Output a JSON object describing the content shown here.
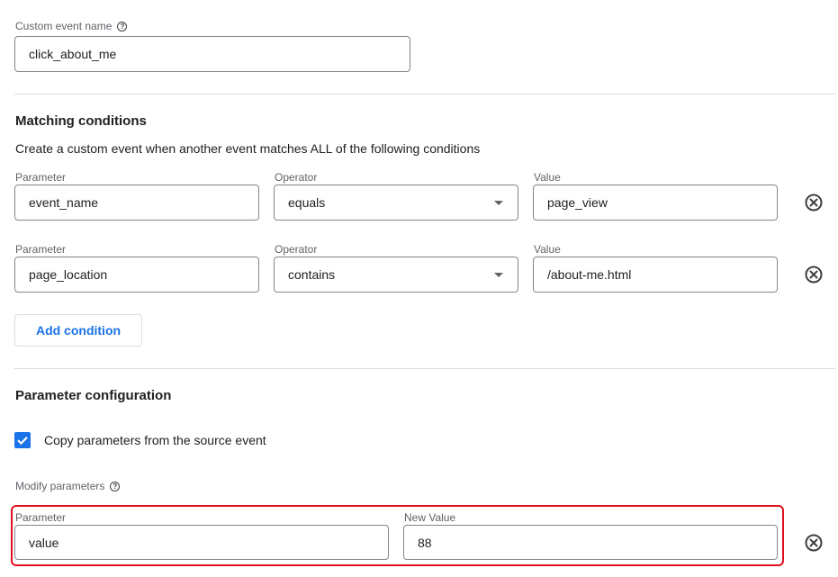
{
  "event_name": {
    "label": "Custom event name",
    "help_icon": "help-icon",
    "value": "click_about_me"
  },
  "matching": {
    "title": "Matching conditions",
    "description": "Create a custom event when another event matches ALL of the following conditions",
    "parameter_label": "Parameter",
    "operator_label": "Operator",
    "value_label": "Value",
    "conditions": [
      {
        "parameter": "event_name",
        "operator": "equals",
        "value": "page_view"
      },
      {
        "parameter": "page_location",
        "operator": "contains",
        "value": "/about-me.html"
      }
    ],
    "add_button": "Add condition",
    "remove_icon": "remove-circle-icon"
  },
  "param_config": {
    "title": "Parameter configuration",
    "copy_label": "Copy parameters from the source event",
    "copy_checked": true,
    "modify_label": "Modify parameters",
    "parameter_label": "Parameter",
    "new_value_label": "New Value",
    "row": {
      "parameter": "value",
      "new_value": "88"
    }
  },
  "colors": {
    "accent": "#1a73e8",
    "highlight": "#e0101b",
    "border": "#80868b",
    "divider": "#dadce0"
  }
}
